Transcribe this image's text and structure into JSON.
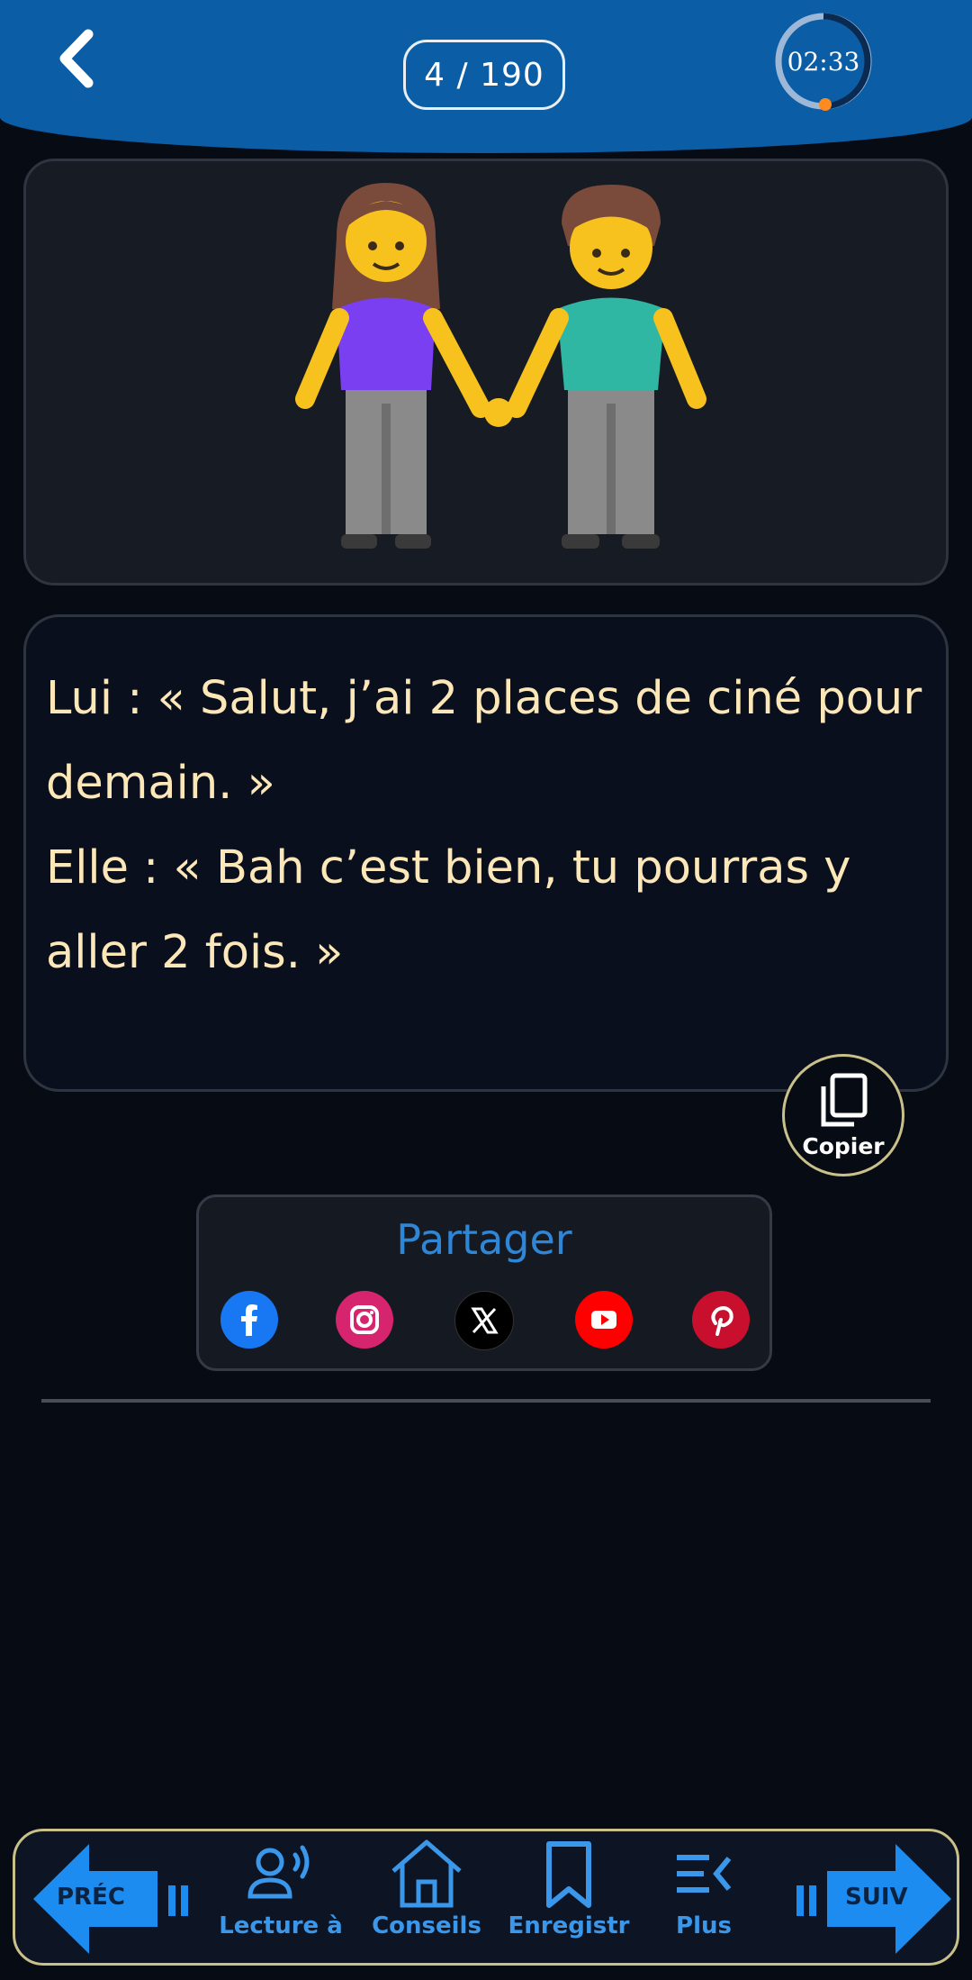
{
  "header": {
    "counter": "4 / 190",
    "timer": "02:33",
    "timer_progress": 0.8,
    "accent_color": "#0b5ea6"
  },
  "joke": {
    "text": "Lui : « Salut, j’ai 2 places de ciné pour demain. »\nElle : « Bah c’est bien, tu pourras y aller 2 fois. »",
    "image_icon": "woman-and-man-holding-hands-emoji"
  },
  "copy": {
    "label": "Copier",
    "icon": "copy-icon"
  },
  "share": {
    "title": "Partager",
    "networks": [
      "facebook-icon",
      "instagram-icon",
      "x-icon",
      "youtube-icon",
      "pinterest-icon"
    ]
  },
  "bottom_nav": {
    "prev_label": "PRÉC",
    "next_label": "SUIV",
    "items": [
      {
        "label": "Lecture à",
        "icon": "voice-reading-icon"
      },
      {
        "label": "Conseils",
        "icon": "home-icon"
      },
      {
        "label": "Enregistr",
        "icon": "bookmark-icon"
      },
      {
        "label": "Plus",
        "icon": "more-list-icon"
      }
    ]
  }
}
